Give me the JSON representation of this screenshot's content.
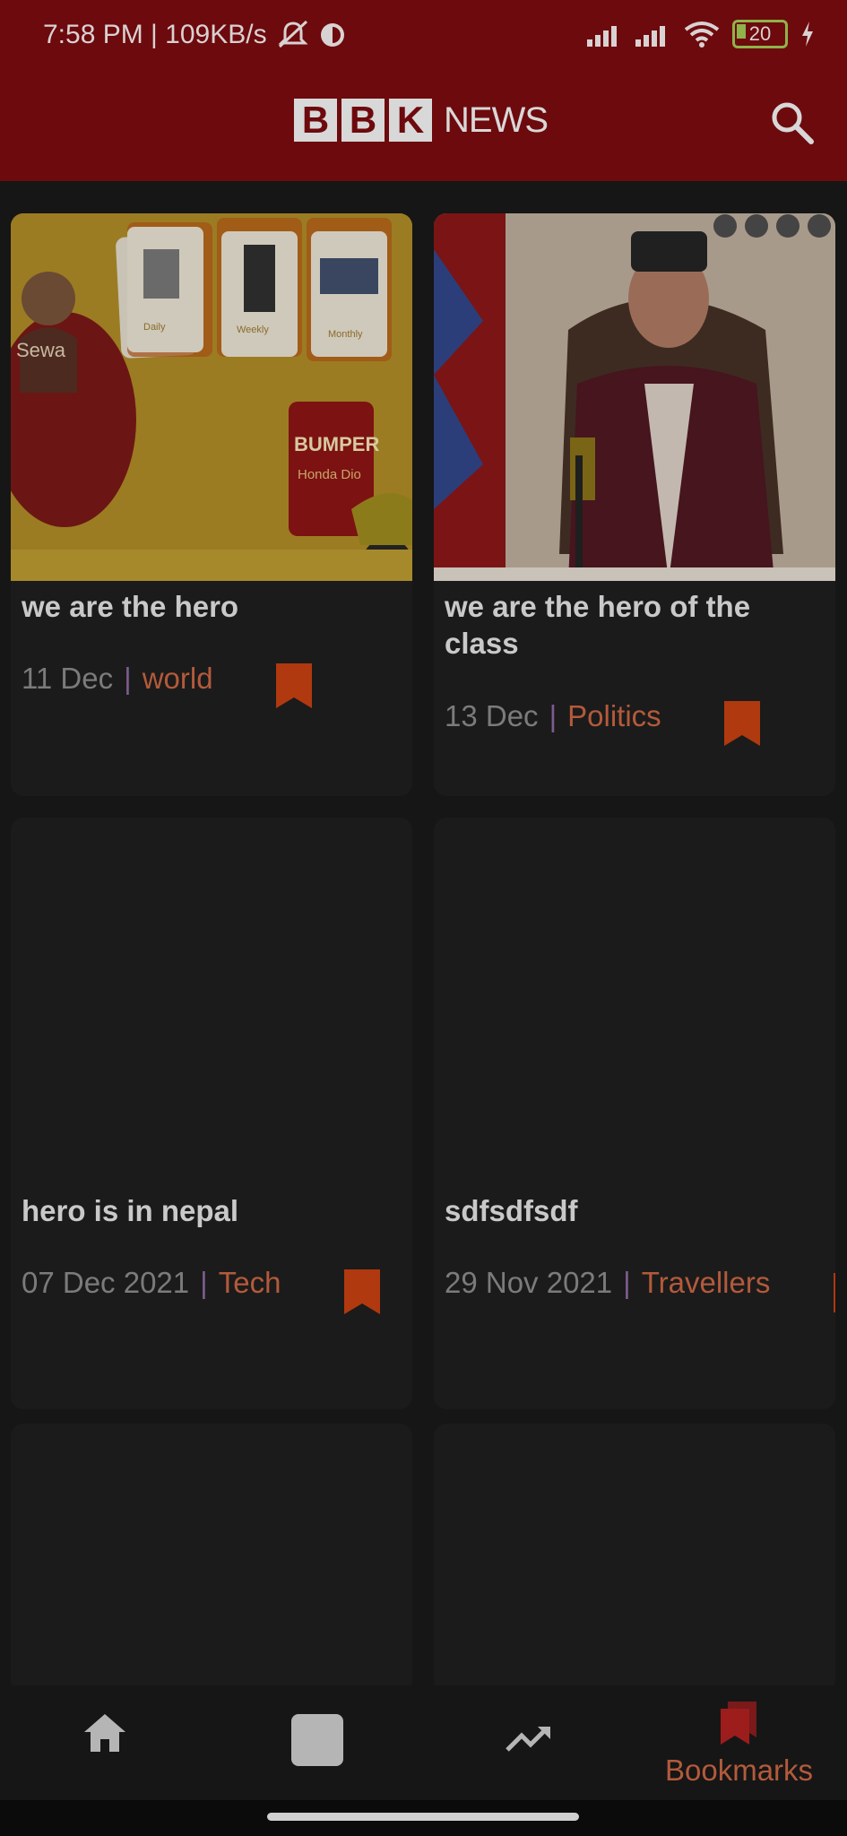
{
  "status": {
    "time_net": "7:58 PM | 109KB/s",
    "battery": "20"
  },
  "header": {
    "logo_letters": [
      "B",
      "B",
      "K"
    ],
    "logo_word": "NEWS"
  },
  "articles": [
    {
      "title": "we are the hero",
      "date": "11 Dec",
      "category": "world"
    },
    {
      "title": "we are the hero of the class",
      "date": "13 Dec",
      "category": "Politics"
    },
    {
      "title": "hero is in nepal",
      "date": "07 Dec 2021",
      "category": "Tech"
    },
    {
      "title": "sdfsdfsdf",
      "date": "29 Nov 2021",
      "category": "Travellers"
    }
  ],
  "separator": "|",
  "ad": {
    "banner_word": "BUMPER",
    "banner_sub": "Honda Dio",
    "brand": "Sewa",
    "deals": [
      "Daily",
      "Weekly",
      "Monthly"
    ]
  },
  "bottom_nav": {
    "active_label": "Bookmarks"
  },
  "colors": {
    "app_bar": "#6d0a0d",
    "accent": "#b35a3b",
    "bookmark": "#b0390f",
    "background": "#161616"
  }
}
